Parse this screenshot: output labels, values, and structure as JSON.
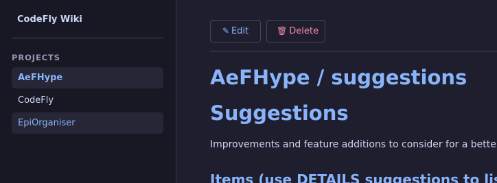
{
  "sidebar": {
    "brand": "CodeFly Wiki",
    "section_label": "PROJECTS",
    "items": [
      {
        "label": "AeFHype"
      },
      {
        "label": "CodeFly"
      },
      {
        "label": "EpiOrganiser"
      }
    ]
  },
  "toolbar": {
    "edit_icon": "✎",
    "edit_label": "Edit",
    "delete_icon": "🗑",
    "delete_label": "Delete"
  },
  "page": {
    "breadcrumb_title": "AeFHype / suggestions",
    "title": "Suggestions",
    "description": "Improvements and feature additions to consider for a better",
    "subheading": "Items (use DETAILS suggestions to list)"
  },
  "colors": {
    "accent": "#89b4fa",
    "danger": "#f38ba8",
    "text": "#cdd6f4",
    "background": "#1e1e2e",
    "sidebar_background": "#181825"
  }
}
